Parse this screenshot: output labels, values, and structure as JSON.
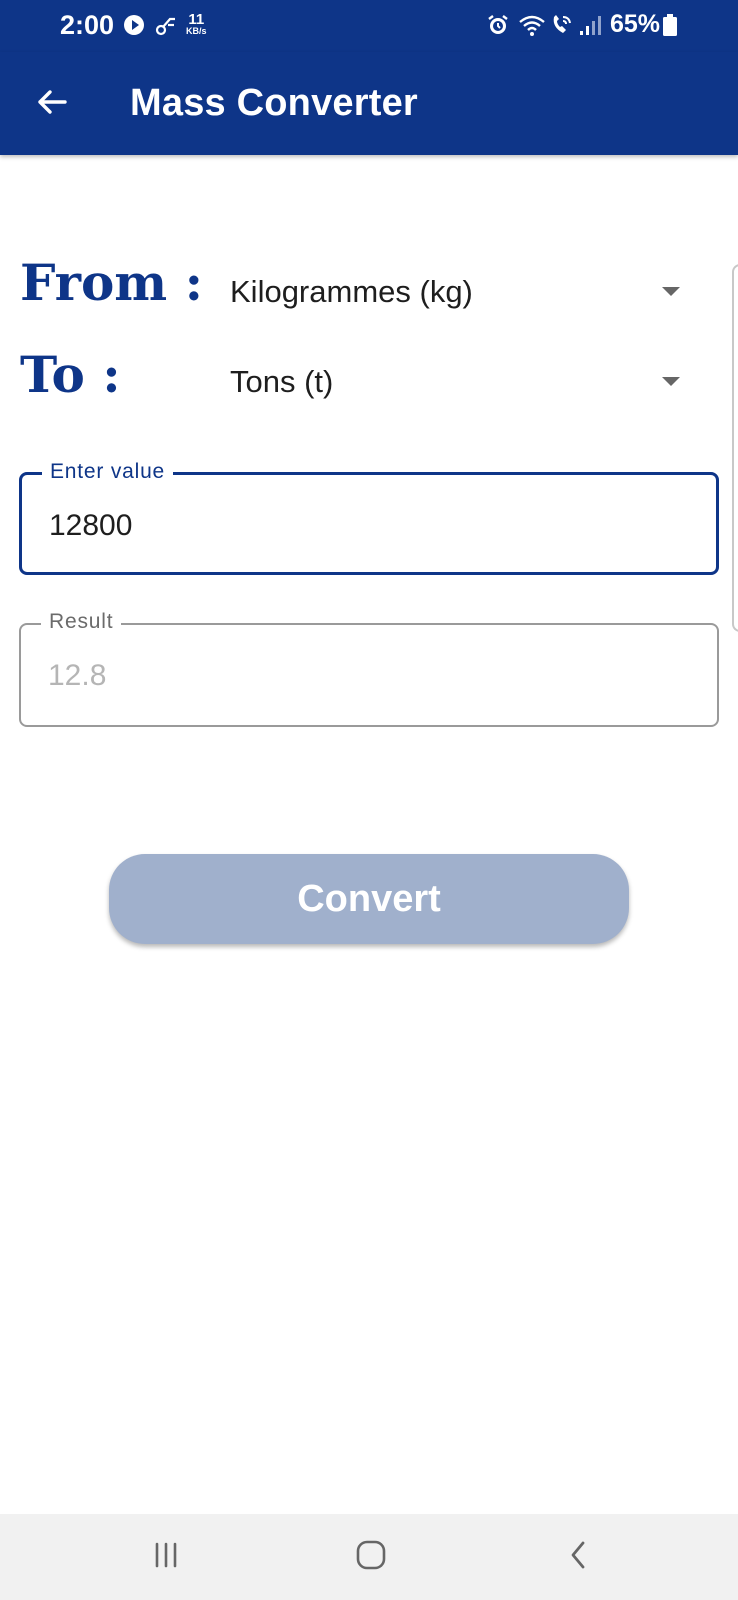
{
  "status_bar": {
    "time": "2:00",
    "speed_value": "11",
    "speed_unit": "KB/s",
    "battery": "65%",
    "icons": [
      "playback-icon",
      "link-icon",
      "alarm-icon",
      "wifi-icon",
      "wifi-calling-icon",
      "signal-icon",
      "battery-icon"
    ]
  },
  "app_bar": {
    "title": "Mass Converter",
    "back_icon": "arrow-left-icon",
    "color": "#0e3588"
  },
  "converter": {
    "from_label": "From :",
    "to_label": "To :",
    "from_unit": "Kilogrammes (kg)",
    "to_unit": "Tons (t)"
  },
  "input": {
    "label": "Enter value",
    "value": "12800"
  },
  "result": {
    "label": "Result",
    "value": "12.8"
  },
  "convert_button": {
    "label": "Convert",
    "color": "#a0b0cc"
  },
  "nav_bar": {
    "icons": [
      "recent-apps-icon",
      "home-icon",
      "back-icon"
    ]
  }
}
